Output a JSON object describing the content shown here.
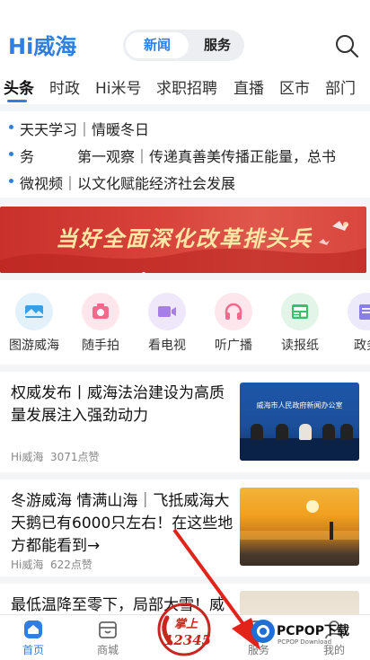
{
  "header": {
    "logo": "Hi威海",
    "segment_active": "新闻",
    "segment_inactive": "服务"
  },
  "channels": [
    "头条",
    "时政",
    "Hi米号",
    "求职招聘",
    "直播",
    "区市",
    "部门"
  ],
  "headlines": [
    "天天学习｜情暖冬日",
    "务　　　第一观察｜传递真善美传播正能量，总书",
    "微视频｜以文化赋能经济社会发展"
  ],
  "banner": {
    "title": "当好全面深化改革排头兵"
  },
  "tools": [
    {
      "label": "图游威海",
      "icon": "map-icon",
      "color": "#e3f1fb"
    },
    {
      "label": "随手拍",
      "icon": "camera-icon",
      "color": "#fde6ec"
    },
    {
      "label": "看电视",
      "icon": "video-icon",
      "color": "#efe8fb"
    },
    {
      "label": "听广播",
      "icon": "headphones-icon",
      "color": "#fde6ec"
    },
    {
      "label": "读报纸",
      "icon": "newspaper-icon",
      "color": "#e2f5e8"
    },
    {
      "label": "政务",
      "icon": "gov-icon",
      "color": "#ece9fb"
    }
  ],
  "news": [
    {
      "title": "权威发布丨威海法治建设为高质量发展注入强劲动力",
      "source": "Hi威海",
      "likes": "3071点赞",
      "image_caption": "威海市人民政府新闻办公室"
    },
    {
      "title": "冬游威海 情满山海｜飞抵威海大天鹅已有6000只左右！在这些地方都能看到→",
      "source": "Hi威海",
      "likes": "622点赞"
    },
    {
      "title": "最低温降至零下，局部大雪！威"
    }
  ],
  "tabbar": {
    "items": [
      {
        "label": "首页",
        "icon": "home-icon",
        "active": true
      },
      {
        "label": "商城",
        "icon": "store-icon",
        "active": false
      },
      {
        "label": "服务",
        "icon": "service-icon",
        "active": false
      },
      {
        "label": "我的",
        "icon": "user-icon",
        "active": false
      }
    ],
    "center_badge": {
      "line1": "掌上",
      "line2": "12345"
    }
  },
  "watermark": {
    "text": "PCPOP下载",
    "sub": "PCPOP Download"
  },
  "colors": {
    "accent": "#2f7fe3",
    "banner": "#d3403a"
  }
}
